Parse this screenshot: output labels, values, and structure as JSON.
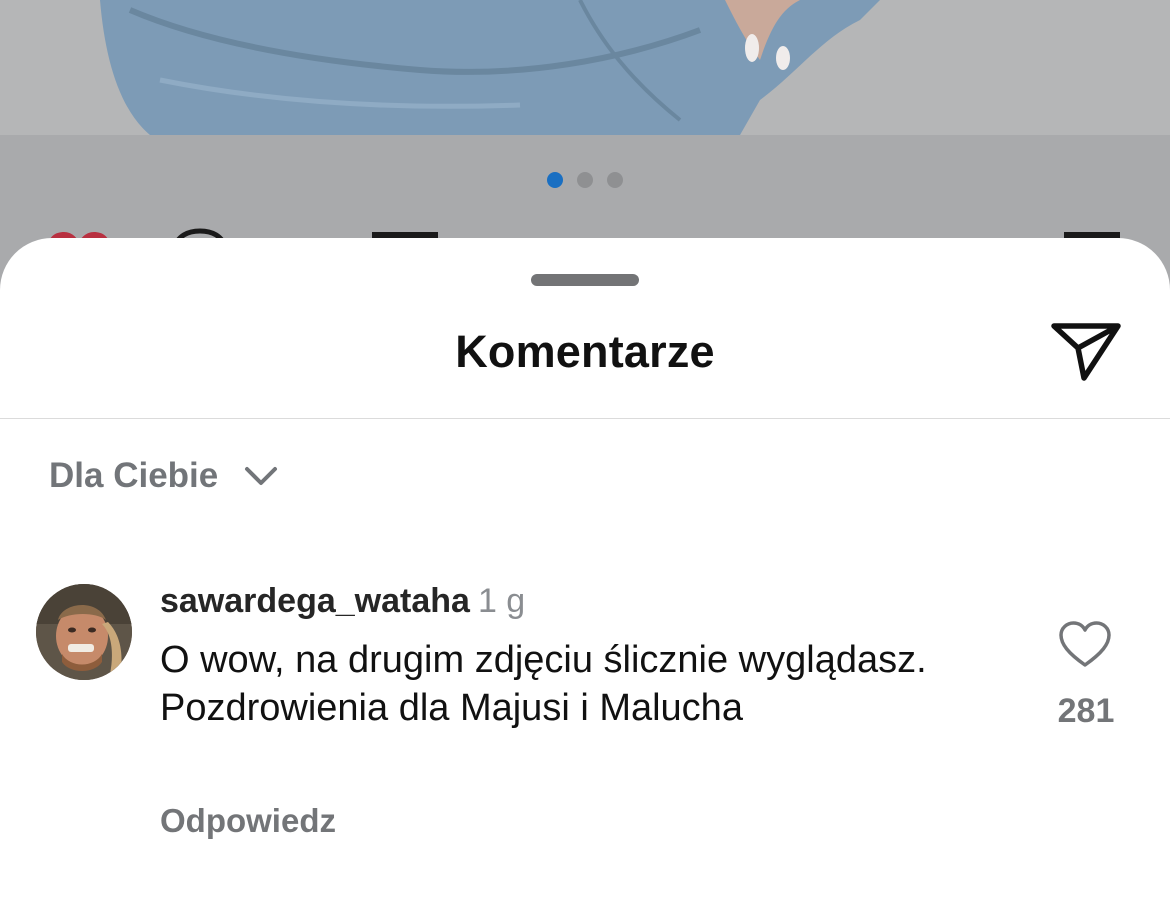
{
  "post": {
    "carousel_total": 3,
    "carousel_active": 1,
    "colors": {
      "active_dot": "#1a6fc2",
      "inactive_dot": "#8f9092"
    },
    "peek_icons": [
      "heart-icon",
      "comment-icon",
      "share-icon",
      "save-icon"
    ]
  },
  "sheet": {
    "title": "Komentarze",
    "share_icon": "paper-plane-icon"
  },
  "sort": {
    "label": "Dla Ciebie",
    "icon": "chevron-down-icon"
  },
  "comments": [
    {
      "username": "sawardega_wataha",
      "time": "1 g",
      "text": "O wow, na drugim zdjęciu ślicznie wyglądasz. Pozdrowienia dla Majusi i Malucha",
      "reply_label": "Odpowiedz",
      "like_count": "281",
      "like_icon": "heart-outline-icon"
    }
  ]
}
